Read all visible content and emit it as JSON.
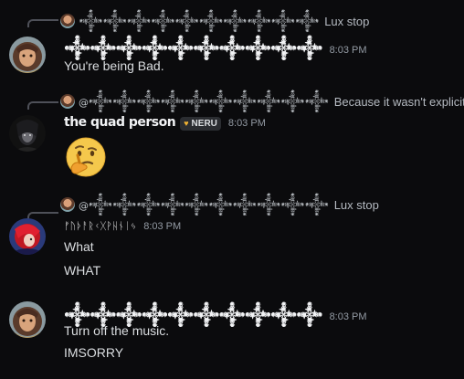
{
  "messages": [
    {
      "reply": {
        "name": "𒀱𒀱𒀱𒀱𒀱𒀱𒀱𒀱𒀱𒀱",
        "text": "Lux stop"
      },
      "author": "𒀱𒀱𒀱𒀱𒀱𒀱𒀱𒀱𒀱𒀱",
      "time": "8:03 PM",
      "lines": [
        "You're being Bad."
      ]
    },
    {
      "reply": {
        "name": "@𒀱𒀱𒀱𒀱𒀱𒀱𒀱𒀱𒀱𒀱",
        "text": "Because it wasn't explicit."
      },
      "author": "the quad person",
      "tag": "NERU",
      "time": "8:03 PM",
      "emoji": "thinking-face"
    },
    {
      "reply": {
        "name": "@𒀱𒀱𒀱𒀱𒀱𒀱𒀱𒀱𒀱𒀱",
        "text": "Lux stop"
      },
      "author": "ᚠᚢᚦᚨᚱᚲᚷᚹᚺᚾᛁᛃ",
      "time": "8:03 PM",
      "lines": [
        "What",
        "WHAT"
      ]
    },
    {
      "author": "𒀱𒀱𒀱𒀱𒀱𒀱𒀱𒀱𒀱𒀱",
      "time": "8:03 PM",
      "lines": [
        "Turn off the music.",
        "IMSORRY"
      ]
    }
  ],
  "colors": {
    "background": "#0b0b0d",
    "text": "#dbdee1",
    "muted": "#949ba4",
    "tag_heart": "#f0b232"
  }
}
